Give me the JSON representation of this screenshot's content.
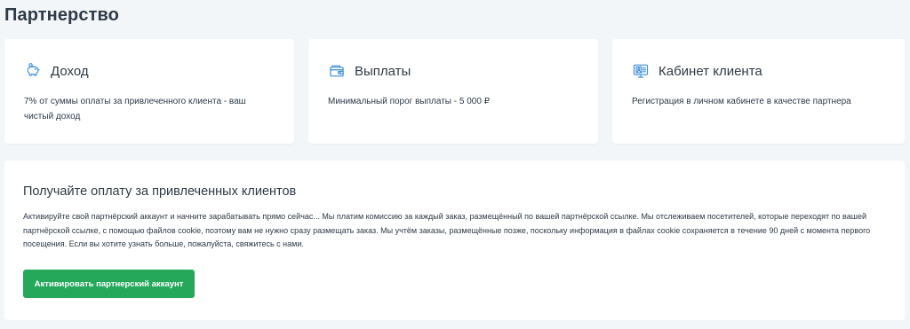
{
  "page": {
    "title": "Партнерство"
  },
  "cards": [
    {
      "icon": "piggy-bank-icon",
      "title": "Доход",
      "text": "7% от суммы оплаты за привлеченного клиента - ваш чистый доход"
    },
    {
      "icon": "wallet-icon",
      "title": "Выплаты",
      "text": "Минимальный порог выплаты - 5 000 ₽"
    },
    {
      "icon": "client-cabinet-icon",
      "title": "Кабинет клиента",
      "text": "Регистрация в личном кабинете в качестве партнера"
    }
  ],
  "main": {
    "heading": "Получайте оплату за привлеченных клиентов",
    "text": "Активируйте свой партнёрский аккаунт и начните зарабатывать прямо сейчас... Мы платим комиссию за каждый заказ, размещённый по вашей партнёрской ссылке. Мы отслеживаем посетителей, которые переходят по вашей партнёрской ссылке, с помощью файлов cookie, поэтому вам не нужно сразу размещать заказ. Мы учтём заказы, размещённые позже, поскольку информация в файлах cookie сохраняется в течение 90 дней с момента первого посещения. Если вы хотите узнать больше, пожалуйста, свяжитесь с нами.",
    "button_label": "Активировать партнерский аккаунт"
  },
  "colors": {
    "accent_green": "#26a85b",
    "icon_blue": "#3d8fd8",
    "background": "#f3f6f9"
  }
}
